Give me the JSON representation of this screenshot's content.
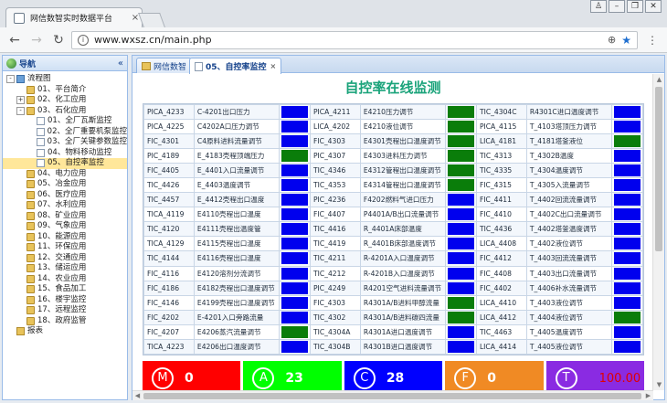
{
  "browser": {
    "tab_title": "网信数智实时数据平台",
    "url": "www.wxsz.cn/main.php"
  },
  "sidebar": {
    "title": "导航",
    "tree": [
      {
        "label": "流程图",
        "level": 0,
        "icon": "root",
        "exp": "-"
      },
      {
        "label": "01、平台简介",
        "level": 1,
        "icon": "folder"
      },
      {
        "label": "02、化工应用",
        "level": 1,
        "icon": "folder",
        "exp": "+"
      },
      {
        "label": "03、石化应用",
        "level": 1,
        "icon": "folder",
        "exp": "-"
      },
      {
        "label": "01、全厂瓦斯监控",
        "level": 2,
        "icon": "doc"
      },
      {
        "label": "02、全厂重要机泵监控",
        "level": 2,
        "icon": "doc"
      },
      {
        "label": "03、全厂关键参数监控",
        "level": 2,
        "icon": "doc"
      },
      {
        "label": "04、物料移动监控",
        "level": 2,
        "icon": "doc"
      },
      {
        "label": "05、自控率监控",
        "level": 2,
        "icon": "doc",
        "selected": true
      },
      {
        "label": "04、电力应用",
        "level": 1,
        "icon": "folder"
      },
      {
        "label": "05、冶金应用",
        "level": 1,
        "icon": "folder"
      },
      {
        "label": "06、医疗应用",
        "level": 1,
        "icon": "folder"
      },
      {
        "label": "07、水利应用",
        "level": 1,
        "icon": "folder"
      },
      {
        "label": "08、矿业应用",
        "level": 1,
        "icon": "folder"
      },
      {
        "label": "09、气象应用",
        "level": 1,
        "icon": "folder"
      },
      {
        "label": "10、能源应用",
        "level": 1,
        "icon": "folder"
      },
      {
        "label": "11、环保应用",
        "level": 1,
        "icon": "folder"
      },
      {
        "label": "12、交通应用",
        "level": 1,
        "icon": "folder"
      },
      {
        "label": "13、储运应用",
        "level": 1,
        "icon": "folder"
      },
      {
        "label": "14、农业应用",
        "level": 1,
        "icon": "folder"
      },
      {
        "label": "15、食品加工",
        "level": 1,
        "icon": "folder"
      },
      {
        "label": "16、楼宇监控",
        "level": 1,
        "icon": "folder"
      },
      {
        "label": "17、远程监控",
        "level": 1,
        "icon": "folder"
      },
      {
        "label": "18、政府监管",
        "level": 1,
        "icon": "folder"
      },
      {
        "label": "报表",
        "level": 0,
        "icon": "report"
      }
    ]
  },
  "tabs": [
    {
      "label": "网信数智",
      "icon": "home"
    },
    {
      "label": "05、自控率监控",
      "icon": "page",
      "active": true
    }
  ],
  "main": {
    "title": "自控率在线监测",
    "rows": [
      [
        "PICA_4233",
        "C-4201出口压力",
        "blue",
        "PICA_4211",
        "E4210压力调节",
        "green",
        "TIC_4304C",
        "R4301C进口温度调节",
        "blue"
      ],
      [
        "PICA_4225",
        "C4202A口压力调节",
        "blue",
        "LICA_4202",
        "E4210液位调节",
        "green",
        "PICA_4115",
        "T_4103塔顶压力调节",
        "blue"
      ],
      [
        "FIC_4301",
        "C4原料进料流量调节",
        "blue",
        "FIC_4303",
        "E4301壳程出口温度调节",
        "green",
        "LICA_4181",
        "T_4181塔釜液位",
        "green"
      ],
      [
        "PIC_4189",
        "E_4183壳程顶端压力",
        "green",
        "PIC_4307",
        "E4303进料压力调节",
        "green",
        "TIC_4313",
        "T_4302B温度",
        "blue"
      ],
      [
        "FIC_4405",
        "E_4401入口流量调节",
        "blue",
        "TIC_4346",
        "E4312管程出口温度调节",
        "green",
        "TIC_4335",
        "T_4304温度调节",
        "blue"
      ],
      [
        "TIC_4426",
        "E_4403温度调节",
        "blue",
        "TIC_4353",
        "E4314管程出口温度调节",
        "green",
        "FIC_4315",
        "T_4305入流量调节",
        "blue"
      ],
      [
        "TIC_4457",
        "E_4412壳程出口温度",
        "blue",
        "PIC_4236",
        "F4202燃料气进口压力",
        "blue",
        "FIC_4411",
        "T_4402回流流量调节",
        "blue"
      ],
      [
        "TICA_4119",
        "E4110壳程出口温度",
        "blue",
        "FIC_4407",
        "P4401A/B出口流量调节",
        "blue",
        "FIC_4410",
        "T_4402C出口流量调节",
        "blue"
      ],
      [
        "TIC_4120",
        "E4111壳程出温度管",
        "blue",
        "TIC_4416",
        "R_4401A床部温度",
        "blue",
        "TIC_4436",
        "T_4402塔釜温度调节",
        "blue"
      ],
      [
        "TICA_4129",
        "E4115壳程出口温度",
        "blue",
        "TIC_4419",
        "R_4401B床部温度调节",
        "blue",
        "LICA_4408",
        "T_4402液位调节",
        "blue"
      ],
      [
        "TIC_4144",
        "E4116壳程出口温度",
        "blue",
        "TIC_4211",
        "R-4201A入口温度调节",
        "blue",
        "FIC_4412",
        "T_4403回流流量调节",
        "blue"
      ],
      [
        "FIC_4116",
        "E4120溶剂分流调节",
        "blue",
        "TIC_4212",
        "R-4201B入口温度调节",
        "blue",
        "FIC_4408",
        "T_4403出口流量调节",
        "blue"
      ],
      [
        "FIC_4186",
        "E4182壳程出口温度调节",
        "blue",
        "PIC_4249",
        "R4201空气进料流量调节",
        "blue",
        "FIC_4402",
        "T_4406补水流量调节",
        "blue"
      ],
      [
        "FIC_4146",
        "E4199壳程出口温度调节",
        "blue",
        "FIC_4303",
        "R4301A/B进料甲醇流量",
        "green",
        "LICA_4410",
        "T_4403液位调节",
        "blue"
      ],
      [
        "FIC_4202",
        "E-4201入口旁路流量",
        "blue",
        "TIC_4302",
        "R4301A/B进料碳四流量",
        "green",
        "LICA_4412",
        "T_4404液位调节",
        "green"
      ],
      [
        "FIC_4207",
        "E4206蒸汽流量调节",
        "green",
        "TIC_4304A",
        "R4301A进口温度调节",
        "blue",
        "TIC_4463",
        "T_4405温度调节",
        "blue"
      ],
      [
        "TICA_4223",
        "E4206出口温度调节",
        "blue",
        "TIC_4304B",
        "R4301B进口温度调节",
        "blue",
        "LICA_4414",
        "T_4405液位调节",
        "blue"
      ]
    ],
    "summary": [
      {
        "letter": "M",
        "value": "0",
        "color": "#ff0000"
      },
      {
        "letter": "A",
        "value": "23",
        "color": "#00ff00"
      },
      {
        "letter": "C",
        "value": "28",
        "color": "#0000ff"
      },
      {
        "letter": "F",
        "value": "0",
        "color": "#f08a24"
      },
      {
        "letter": "T",
        "value": "100.00",
        "color": "#8a2be2"
      }
    ]
  }
}
